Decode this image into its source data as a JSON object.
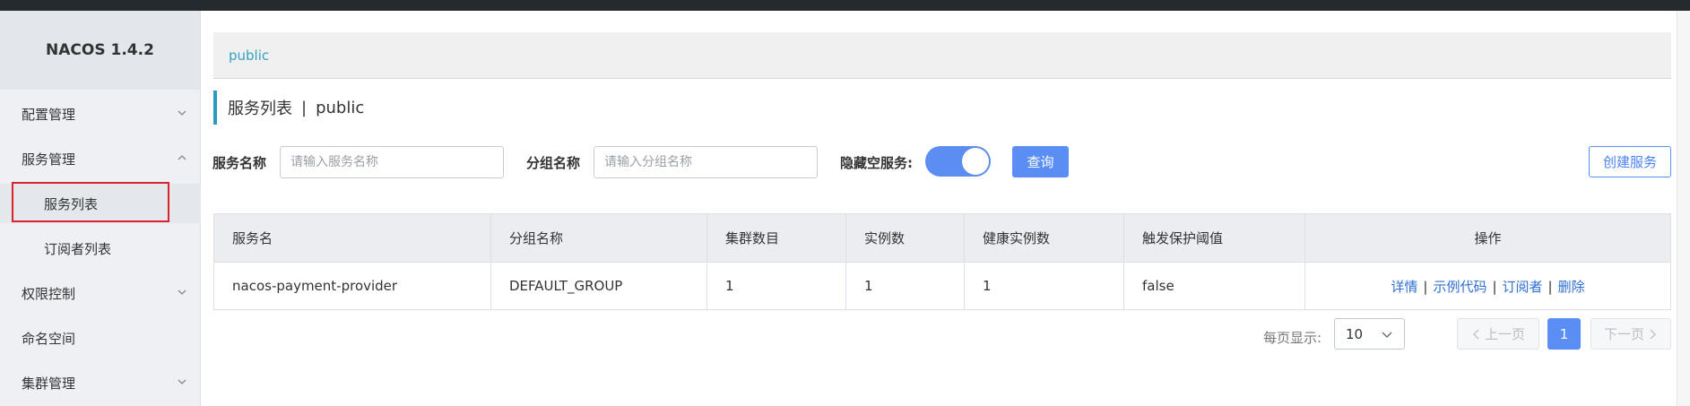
{
  "app": {
    "brand": "NACOS 1.4.2"
  },
  "sidebar": {
    "items": [
      {
        "label": "配置管理"
      },
      {
        "label": "服务管理"
      },
      {
        "label": "服务列表"
      },
      {
        "label": "订阅者列表"
      },
      {
        "label": "权限控制"
      },
      {
        "label": "命名空间"
      },
      {
        "label": "集群管理"
      }
    ]
  },
  "breadcrumb": {
    "namespace": "public"
  },
  "page": {
    "title": "服务列表",
    "separator": "|",
    "namespace": "public"
  },
  "filters": {
    "service_name_label": "服务名称",
    "service_name_placeholder": "请输入服务名称",
    "group_name_label": "分组名称",
    "group_name_placeholder": "请输入分组名称",
    "hide_empty_label": "隐藏空服务:",
    "hide_empty_enabled": true,
    "query_button": "查询",
    "create_button": "创建服务"
  },
  "table": {
    "headers": [
      "服务名",
      "分组名称",
      "集群数目",
      "实例数",
      "健康实例数",
      "触发保护阈值",
      "操作"
    ],
    "rows": [
      {
        "service": "nacos-payment-provider",
        "group": "DEFAULT_GROUP",
        "clusters": "1",
        "instances": "1",
        "healthy": "1",
        "threshold": "false",
        "actions": [
          "详情",
          "示例代码",
          "订阅者",
          "删除"
        ]
      }
    ]
  },
  "pagination": {
    "page_size_label": "每页显示:",
    "page_size": "10",
    "prev": "上一页",
    "current": "1",
    "next": "下一页"
  },
  "colors": {
    "accent": "#5b8ef4",
    "link": "#2f6fd1",
    "breadcrumb": "#35a2c1",
    "highlight": "#d9232e"
  }
}
